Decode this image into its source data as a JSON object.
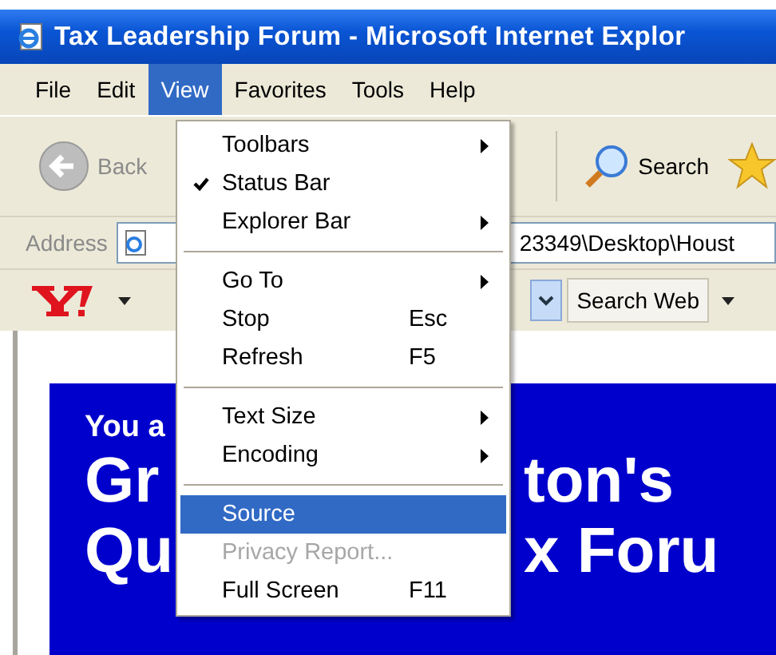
{
  "window": {
    "title": "Tax Leadership Forum - Microsoft Internet Explor"
  },
  "menu_bar": [
    {
      "label": "File",
      "selected": false
    },
    {
      "label": "Edit",
      "selected": false
    },
    {
      "label": "View",
      "selected": true
    },
    {
      "label": "Favorites",
      "selected": false
    },
    {
      "label": "Tools",
      "selected": false
    },
    {
      "label": "Help",
      "selected": false
    }
  ],
  "toolbar": {
    "back": "Back",
    "search": "Search"
  },
  "address_bar": {
    "label": "Address",
    "value": "23349\\Desktop\\Houst"
  },
  "yahoo_toolbar": {
    "search_button": "Search Web"
  },
  "view_menu": [
    {
      "kind": "item",
      "label": "Toolbars",
      "submenu": true,
      "checked": false,
      "selected": false,
      "disabled": false
    },
    {
      "kind": "item",
      "label": "Status Bar",
      "submenu": false,
      "checked": true,
      "selected": false,
      "disabled": false
    },
    {
      "kind": "item",
      "label": "Explorer Bar",
      "submenu": true,
      "checked": false,
      "selected": false,
      "disabled": false
    },
    {
      "kind": "separator"
    },
    {
      "kind": "item",
      "label": "Go To",
      "submenu": true,
      "checked": false,
      "selected": false,
      "disabled": false
    },
    {
      "kind": "item",
      "label": "Stop",
      "shortcut": "Esc",
      "submenu": false,
      "checked": false,
      "selected": false,
      "disabled": false
    },
    {
      "kind": "item",
      "label": "Refresh",
      "shortcut": "F5",
      "submenu": false,
      "checked": false,
      "selected": false,
      "disabled": false
    },
    {
      "kind": "separator"
    },
    {
      "kind": "item",
      "label": "Text Size",
      "submenu": true,
      "checked": false,
      "selected": false,
      "disabled": false
    },
    {
      "kind": "item",
      "label": "Encoding",
      "submenu": true,
      "checked": false,
      "selected": false,
      "disabled": false
    },
    {
      "kind": "separator"
    },
    {
      "kind": "item",
      "label": "Source",
      "submenu": false,
      "checked": false,
      "selected": true,
      "disabled": false
    },
    {
      "kind": "item",
      "label": "Privacy Report...",
      "submenu": false,
      "checked": false,
      "selected": false,
      "disabled": true
    },
    {
      "kind": "item",
      "label": "Full Screen",
      "shortcut": "F11",
      "submenu": false,
      "checked": false,
      "selected": false,
      "disabled": false
    }
  ],
  "page": {
    "banner_lines": [
      {
        "kind": "small",
        "left": "You a"
      },
      {
        "kind": "large",
        "left": "Gr",
        "right": "ton's"
      },
      {
        "kind": "large",
        "left": "Qu",
        "right": "x Foru"
      }
    ]
  }
}
